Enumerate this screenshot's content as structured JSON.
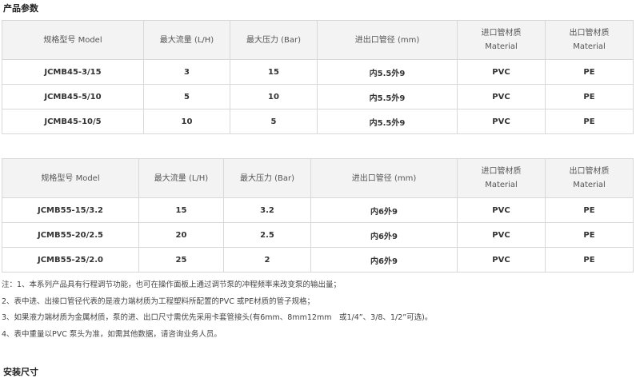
{
  "heading_params": "产品参数",
  "heading_install": "安装尺寸",
  "tables": [
    {
      "headers": [
        [
          "规格型号 Model"
        ],
        [
          "最大流量 (L/H)"
        ],
        [
          "最大压力 (Bar)"
        ],
        [
          "进出口管径 (mm)"
        ],
        [
          "进口管材质",
          "Material"
        ],
        [
          "出口管材质",
          "Material"
        ]
      ],
      "rows": [
        [
          "JCMB45-3/15",
          "3",
          "15",
          "内5.5外9",
          "PVC",
          "PE"
        ],
        [
          "JCMB45-5/10",
          "5",
          "10",
          "内5.5外9",
          "PVC",
          "PE"
        ],
        [
          "JCMB45-10/5",
          "10",
          "5",
          "内5.5外9",
          "PVC",
          "PE"
        ]
      ]
    },
    {
      "headers": [
        [
          "规格型号 Model"
        ],
        [
          "最大流量 (L/H)"
        ],
        [
          "最大压力 (Bar)"
        ],
        [
          "进出口管径 (mm)"
        ],
        [
          "进口管材质",
          "Material"
        ],
        [
          "出口管材质",
          "Material"
        ]
      ],
      "rows": [
        [
          "JCMB55-15/3.2",
          "15",
          "3.2",
          "内6外9",
          "PVC",
          "PE"
        ],
        [
          "JCMB55-20/2.5",
          "20",
          "2.5",
          "内6外9",
          "PVC",
          "PE"
        ],
        [
          "JCMB55-25/2.0",
          "25",
          "2",
          "内6外9",
          "PVC",
          "PE"
        ]
      ]
    }
  ],
  "notes": [
    "注：1、本系列产品具有行程调节功能，也可在操作面板上通过调节泵的冲程频率来改变泵的输出量；",
    "2、表中进、出接口管径代表的是液力端材质为工程塑料所配置的PVC 或PE材质的管子规格；",
    "3、如果液力端材质为金属材质，泵的进、出口尺寸需优先采用卡套管接头(有6mm、8mm12mm　或1/4”、3/8、1/2”可选)。",
    "4、表中重量以PVC 泵头为准，如需其他数据，请咨询业务人员。"
  ]
}
